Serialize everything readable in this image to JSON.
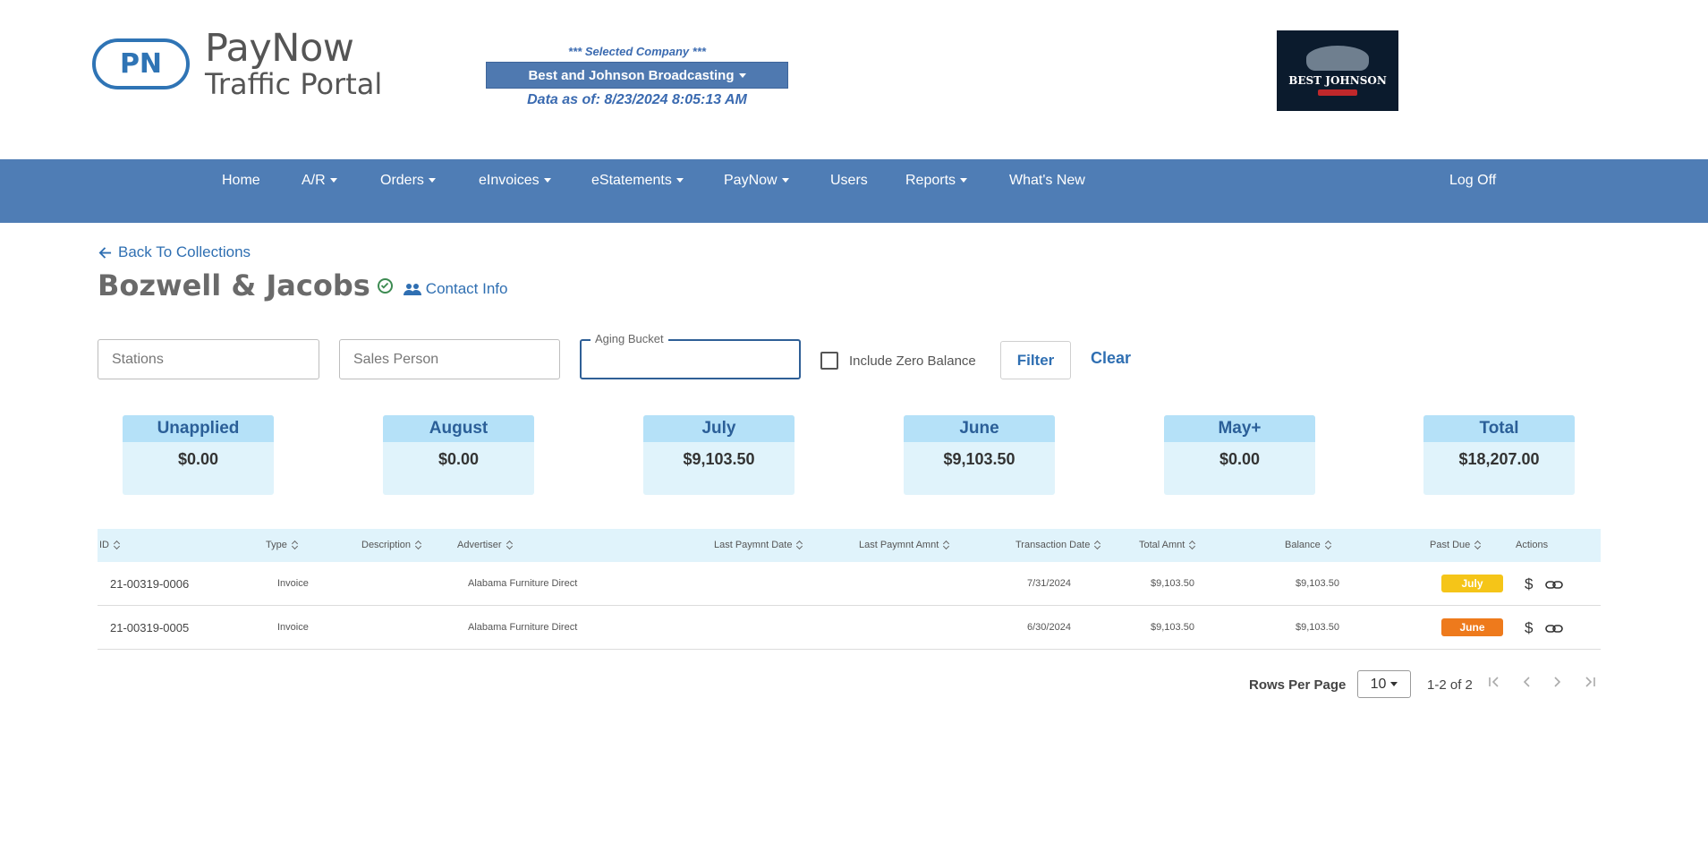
{
  "brand": {
    "badge": "PN",
    "title": "PayNow",
    "subtitle": "Traffic Portal"
  },
  "company": {
    "label": "*** Selected Company ***",
    "name": "Best and Johnson Broadcasting",
    "data_as_of": "Data as of: 8/23/2024 8:05:13 AM",
    "logo_text": "BEST JOHNSON"
  },
  "nav": {
    "items": [
      "Home",
      "A/R",
      "Orders",
      "eInvoices",
      "eStatements",
      "PayNow",
      "Users",
      "Reports",
      "What's New"
    ],
    "logoff": "Log Off"
  },
  "page": {
    "back": "Back To Collections",
    "title": "Bozwell & Jacobs",
    "contact": "Contact Info"
  },
  "filters": {
    "stations_placeholder": "Stations",
    "sales_placeholder": "Sales Person",
    "aging_label": "Aging Bucket",
    "aging_value": "",
    "zero_balance_label": "Include Zero Balance",
    "zero_balance_checked": false,
    "filter_btn": "Filter",
    "clear_btn": "Clear"
  },
  "buckets": [
    {
      "title": "Unapplied",
      "value": "$0.00"
    },
    {
      "title": "August",
      "value": "$0.00"
    },
    {
      "title": "July",
      "value": "$9,103.50"
    },
    {
      "title": "June",
      "value": "$9,103.50"
    },
    {
      "title": "May+",
      "value": "$0.00"
    },
    {
      "title": "Total",
      "value": "$18,207.00"
    }
  ],
  "table": {
    "columns": [
      "ID",
      "Type",
      "Description",
      "Advertiser",
      "Last Paymnt Date",
      "Last Paymnt Amnt",
      "Transaction Date",
      "Total Amnt",
      "Balance",
      "Past Due",
      "Actions"
    ],
    "rows": [
      {
        "id": "21-00319-0006",
        "type": "Invoice",
        "description": "",
        "advertiser": "Alabama Furniture Direct",
        "last_date": "",
        "last_amount": "",
        "transaction_date": "7/31/2024",
        "total": "$9,103.50",
        "balance": "$9,103.50",
        "past_due": "July",
        "past_due_color": "#f5c518"
      },
      {
        "id": "21-00319-0005",
        "type": "Invoice",
        "description": "",
        "advertiser": "Alabama Furniture Direct",
        "last_date": "",
        "last_amount": "",
        "transaction_date": "6/30/2024",
        "total": "$9,103.50",
        "balance": "$9,103.50",
        "past_due": "June",
        "past_due_color": "#ee7a1c"
      }
    ]
  },
  "pagination": {
    "rows_per_page_label": "Rows Per Page",
    "rows_per_page": "10",
    "range": "1-2 of 2"
  },
  "colors": {
    "nav": "#4f7db5",
    "accent": "#2f6fb2",
    "bucket_header": "#b5e1f8",
    "bucket_body": "#e0f3fb"
  }
}
